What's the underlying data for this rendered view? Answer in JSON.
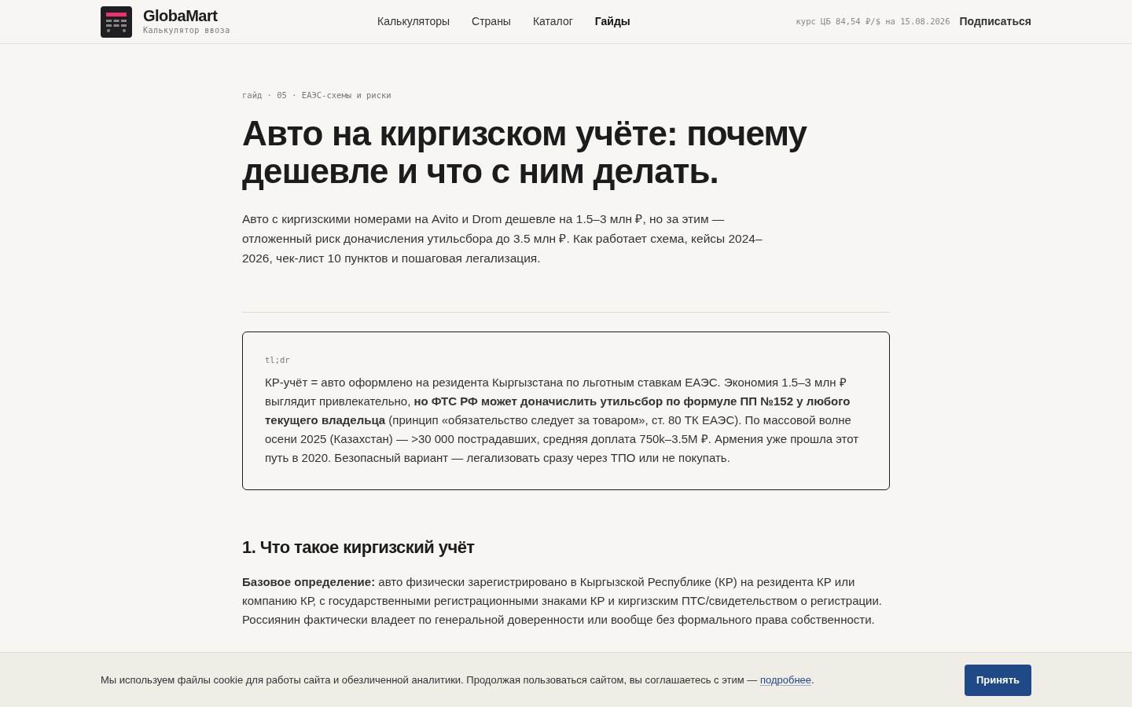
{
  "header": {
    "brand": "GlobaMart",
    "tagline": "Калькулятор ввоза",
    "nav": [
      {
        "label": "Калькуляторы",
        "selected": false
      },
      {
        "label": "Страны",
        "selected": false
      },
      {
        "label": "Каталог",
        "selected": false
      },
      {
        "label": "Гайды",
        "selected": true
      }
    ],
    "rate": "курс ЦБ 84,54 ₽/$ на 15.08.2026",
    "subscribe": "Подписаться"
  },
  "article": {
    "eyebrow": "гайд · 05 · ЕАЭС-схемы и риски",
    "title": "Авто на киргизском учёте: почему дешевле и что с ним делать.",
    "lead": "Авто с киргизскими номерами на Avito и Drom дешевле на 1.5–3 млн ₽, но за этим — отложенный риск доначисления утильсбора до 3.5 млн ₽. Как работает схема, кейсы 2024–2026, чек-лист 10 пунктов и пошаговая легализация.",
    "tldr": {
      "label": "tl;dr",
      "text": "КР-учёт = авто оформлено на резидента Кыргызстана по льготным ставкам ЕАЭС. Экономия 1.5–3 млн ₽ выглядит привлекательно, **но ФТС РФ может доначислить утильсбор по формуле ПП №152 у любого текущего владельца** (принцип «обязательство следует за товаром», ст. 80 ТК ЕАЭС). По массовой волне осени 2025 (Казахстан) — >30 000 пострадавших, средняя доплата 750k–3.5M ₽. Армения уже прошла этот путь в 2020. Безопасный вариант — легализовать сразу через ТПО или не покупать."
    },
    "section_title": "1. Что такое киргизский учёт",
    "paragraph": "**Базовое определение:** авто физически зарегистрировано в Кыргызской Республике (КР) на резидента КР или компанию КР, с государственными регистрационными знаками КР и киргизским ПТС/свидетельством о регистрации. Россиянин фактически владеет по генеральной доверенности или вообще без формального права собственности."
  },
  "cookie": {
    "text": "Мы используем файлы cookie для работы сайта и обезличенной аналитики. Продолжая пользоваться сайтом, вы соглашаетесь с этим —",
    "link": "подробнее",
    "after": ".",
    "accept": "Принять"
  }
}
